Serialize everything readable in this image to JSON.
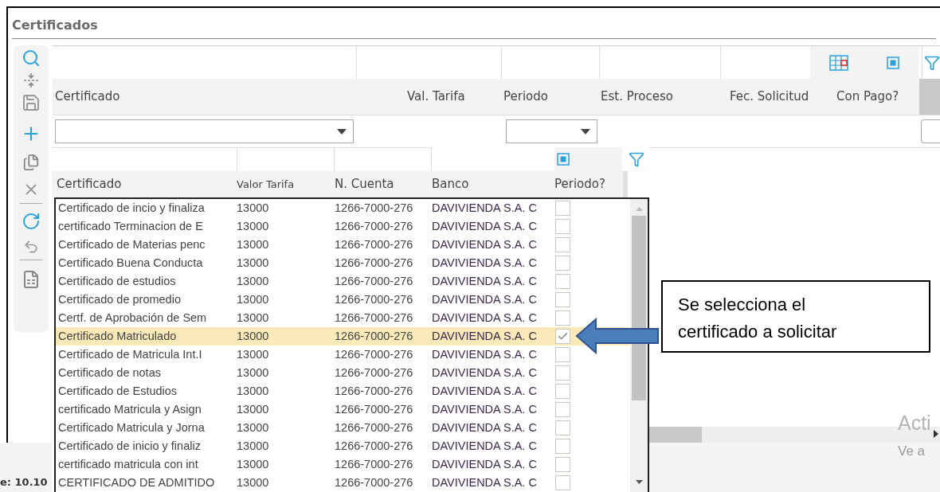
{
  "title": "Certificados",
  "grid": {
    "columns": [
      "Certificado",
      "Val. Tarifa",
      "Periodo",
      "Est. Proceso",
      "Fec. Solicitud",
      "Con Pago?"
    ]
  },
  "dropdown": {
    "columns": [
      "Certificado",
      "Valor Tarifa",
      "N. Cuenta",
      "Banco",
      "Periodo?"
    ],
    "rows": [
      {
        "certificado": "Certificado de incio y finaliza",
        "valor": "13000",
        "cuenta": "1266-7000-276",
        "banco": "DAVIVIENDA S.A. C",
        "checked": false,
        "selected": false
      },
      {
        "certificado": "certificado Terminacion de E",
        "valor": "13000",
        "cuenta": "1266-7000-276",
        "banco": "DAVIVIENDA S.A. C",
        "checked": false,
        "selected": false
      },
      {
        "certificado": "Certificado de Materias penc",
        "valor": "13000",
        "cuenta": "1266-7000-276",
        "banco": "DAVIVIENDA S.A. C",
        "checked": false,
        "selected": false
      },
      {
        "certificado": "Certificado Buena Conducta",
        "valor": "13000",
        "cuenta": "1266-7000-276",
        "banco": "DAVIVIENDA S.A. C",
        "checked": false,
        "selected": false
      },
      {
        "certificado": "Certificado de estudios",
        "valor": "13000",
        "cuenta": "1266-7000-276",
        "banco": "DAVIVIENDA S.A. C",
        "checked": false,
        "selected": false
      },
      {
        "certificado": "Certificado de promedio",
        "valor": "13000",
        "cuenta": "1266-7000-276",
        "banco": "DAVIVIENDA S.A. C",
        "checked": false,
        "selected": false
      },
      {
        "certificado": "Certf. de Aprobación de Sem",
        "valor": "13000",
        "cuenta": "1266-7000-276",
        "banco": "DAVIVIENDA S.A. C",
        "checked": false,
        "selected": false
      },
      {
        "certificado": "Certificado Matriculado",
        "valor": "13000",
        "cuenta": "1266-7000-276",
        "banco": "DAVIVIENDA S.A. C",
        "checked": true,
        "selected": true
      },
      {
        "certificado": "Certificado de Matricula Int.I",
        "valor": "13000",
        "cuenta": "1266-7000-276",
        "banco": "DAVIVIENDA S.A. C",
        "checked": false,
        "selected": false
      },
      {
        "certificado": "Certificado de notas",
        "valor": "13000",
        "cuenta": "1266-7000-276",
        "banco": "DAVIVIENDA S.A. C",
        "checked": false,
        "selected": false
      },
      {
        "certificado": "Certificado de Estudios",
        "valor": "13000",
        "cuenta": "1266-7000-276",
        "banco": "DAVIVIENDA S.A. C",
        "checked": false,
        "selected": false
      },
      {
        "certificado": "certificado Matricula y Asign",
        "valor": "13000",
        "cuenta": "1266-7000-276",
        "banco": "DAVIVIENDA S.A. C",
        "checked": false,
        "selected": false
      },
      {
        "certificado": "Certificado Matricula y Jorna",
        "valor": "13000",
        "cuenta": "1266-7000-276",
        "banco": "DAVIVIENDA S.A. C",
        "checked": false,
        "selected": false
      },
      {
        "certificado": "Certificado de inicio y finaliz",
        "valor": "13000",
        "cuenta": "1266-7000-276",
        "banco": "DAVIVIENDA S.A. C",
        "checked": false,
        "selected": false
      },
      {
        "certificado": "certificado matricula con int",
        "valor": "13000",
        "cuenta": "1266-7000-276",
        "banco": "DAVIVIENDA S.A. C",
        "checked": false,
        "selected": false
      },
      {
        "certificado": "CERTIFICADO DE ADMITIDO",
        "valor": "13000",
        "cuenta": "1266-7000-276",
        "banco": "DAVIVIENDA S.A. C",
        "checked": false,
        "selected": false
      }
    ]
  },
  "status": "e: 10.10",
  "callout": "Se selecciona el certificado a solicitar",
  "watermark": [
    "Acti",
    "Ve a"
  ]
}
